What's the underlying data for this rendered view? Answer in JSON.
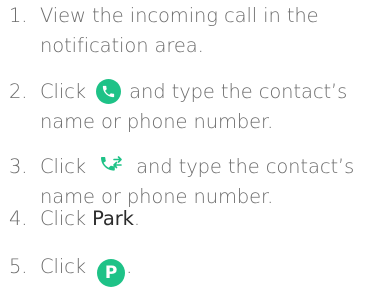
{
  "steps": [
    {
      "number": "1.",
      "line1": "View the incoming call in the",
      "line2": "notification area."
    },
    {
      "number": "2.",
      "before_icon": "Click",
      "icon": "phone-answer-icon",
      "after_icon": "and type the contact’s",
      "line2": "name or phone number."
    },
    {
      "number": "3.",
      "before_icon": "Click",
      "icon": "phone-transfer-icon",
      "after_icon": "and type the contact’s",
      "line2": "name or phone number."
    },
    {
      "number": "4.",
      "before_bold": "Click",
      "bold": "Park",
      "after_bold": "."
    },
    {
      "number": "5.",
      "before_icon": "Click",
      "icon": "park-icon",
      "icon_letter": "P",
      "after_icon": "."
    }
  ],
  "colors": {
    "text": "#6b6b6b",
    "emphasis": "#2c2c2c",
    "accent": "#1ec287"
  }
}
